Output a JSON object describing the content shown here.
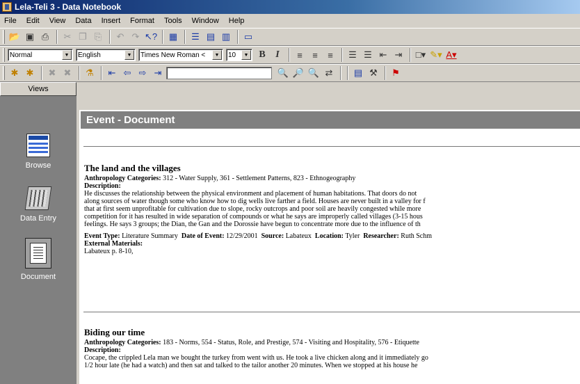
{
  "window": {
    "title": "Lela-Teli 3 - Data Notebook"
  },
  "menu": [
    "File",
    "Edit",
    "View",
    "Data",
    "Insert",
    "Format",
    "Tools",
    "Window",
    "Help"
  ],
  "format_toolbar": {
    "style": "Normal",
    "language": "English",
    "font": "Times New Roman <",
    "size": "10"
  },
  "views": {
    "header": "Views",
    "items": [
      {
        "label": "Browse",
        "icon": "browse-icon"
      },
      {
        "label": "Data Entry",
        "icon": "data-entry-icon"
      },
      {
        "label": "Document",
        "icon": "document-icon"
      }
    ]
  },
  "document": {
    "header": "Event - Document",
    "entries": [
      {
        "title": "The land and the villages",
        "categories_label": "Anthropology Categories:",
        "categories": "312 - Water Supply, 361 - Settlement Patterns, 823 - Ethnogeography",
        "description_label": "Description:",
        "description_lines": [
          "He discusses the relationship between the physical environment and placement of human habitations. That doors do not",
          "along sources of water though some who know how to dig wells live farther a field. Houses are never built in a valley for f",
          "that at first seem unprofitable for cultivation due to slope, rocky outcrops and poor soil are heavily congested while more",
          "competition for it has resulted in wide separation of compounds or what he says are improperly called villages (3-15 hous",
          "feelings. He says 3 groups; the Dian, the Gan and the Dorossie have begun to concentrate more due to the influence of th"
        ],
        "meta": {
          "event_type_label": "Event Type:",
          "event_type": "Literature Summary",
          "date_label": "Date of Event:",
          "date": "12/29/2001",
          "source_label": "Source:",
          "source": "Labateux",
          "location_label": "Location:",
          "location": "Tyler",
          "researcher_label": "Researcher:",
          "researcher": "Ruth Schm"
        },
        "materials_label": "External Materials:",
        "materials": "Labateux p. 8-10,"
      },
      {
        "title": "Biding our time",
        "categories_label": "Anthropology Categories:",
        "categories": "183 - Norms, 554 - Status, Role, and Prestige, 574 - Visiting and Hospitality, 576 - Etiquette",
        "description_label": "Description:",
        "description_lines": [
          "Cocape, the crippled Lela man we bought the turkey from went with us. He took a live chicken along and it immediately go",
          "1/2 hour late (he had a watch) and then sat and talked to the tailor another 20 minutes. When we stopped at his house he"
        ]
      }
    ]
  }
}
